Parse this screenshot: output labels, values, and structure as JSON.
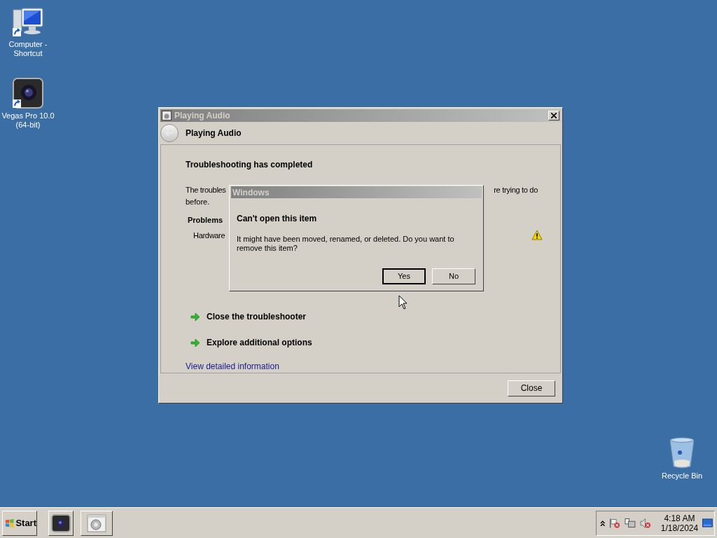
{
  "desktop_icons": [
    {
      "kind": "computer",
      "label": "Computer - Shortcut"
    },
    {
      "kind": "camera",
      "label": "Vegas Pro 10.0 (64-bit)"
    },
    {
      "kind": "recycle",
      "label": "Recycle Bin"
    }
  ],
  "window": {
    "title": "Playing Audio",
    "header": "Playing Audio",
    "heading": "Troubleshooting has completed",
    "message_start": "The troubles",
    "message_end": "re trying to do",
    "message_line_2": "before.",
    "problems_label": "Problems",
    "problems": [
      {
        "name": "Hardware",
        "kind": "warning"
      }
    ],
    "options": [
      "Close the troubleshooter",
      "Explore additional options"
    ],
    "link": "View detailed information",
    "close_button": "Close"
  },
  "dialog": {
    "title": "Windows",
    "heading": "Can't open this item",
    "message": "It might have been moved, renamed, or deleted. Do you want to remove this item?",
    "buttons": [
      {
        "label": "Yes",
        "default": true
      },
      {
        "label": "No",
        "default": false
      }
    ]
  },
  "taskbar": {
    "start": "Start",
    "tasks": [
      {
        "kind": "camera"
      },
      {
        "kind": "troubleshooter"
      }
    ],
    "time": "4:18 AM",
    "date": "1/18/2024"
  }
}
